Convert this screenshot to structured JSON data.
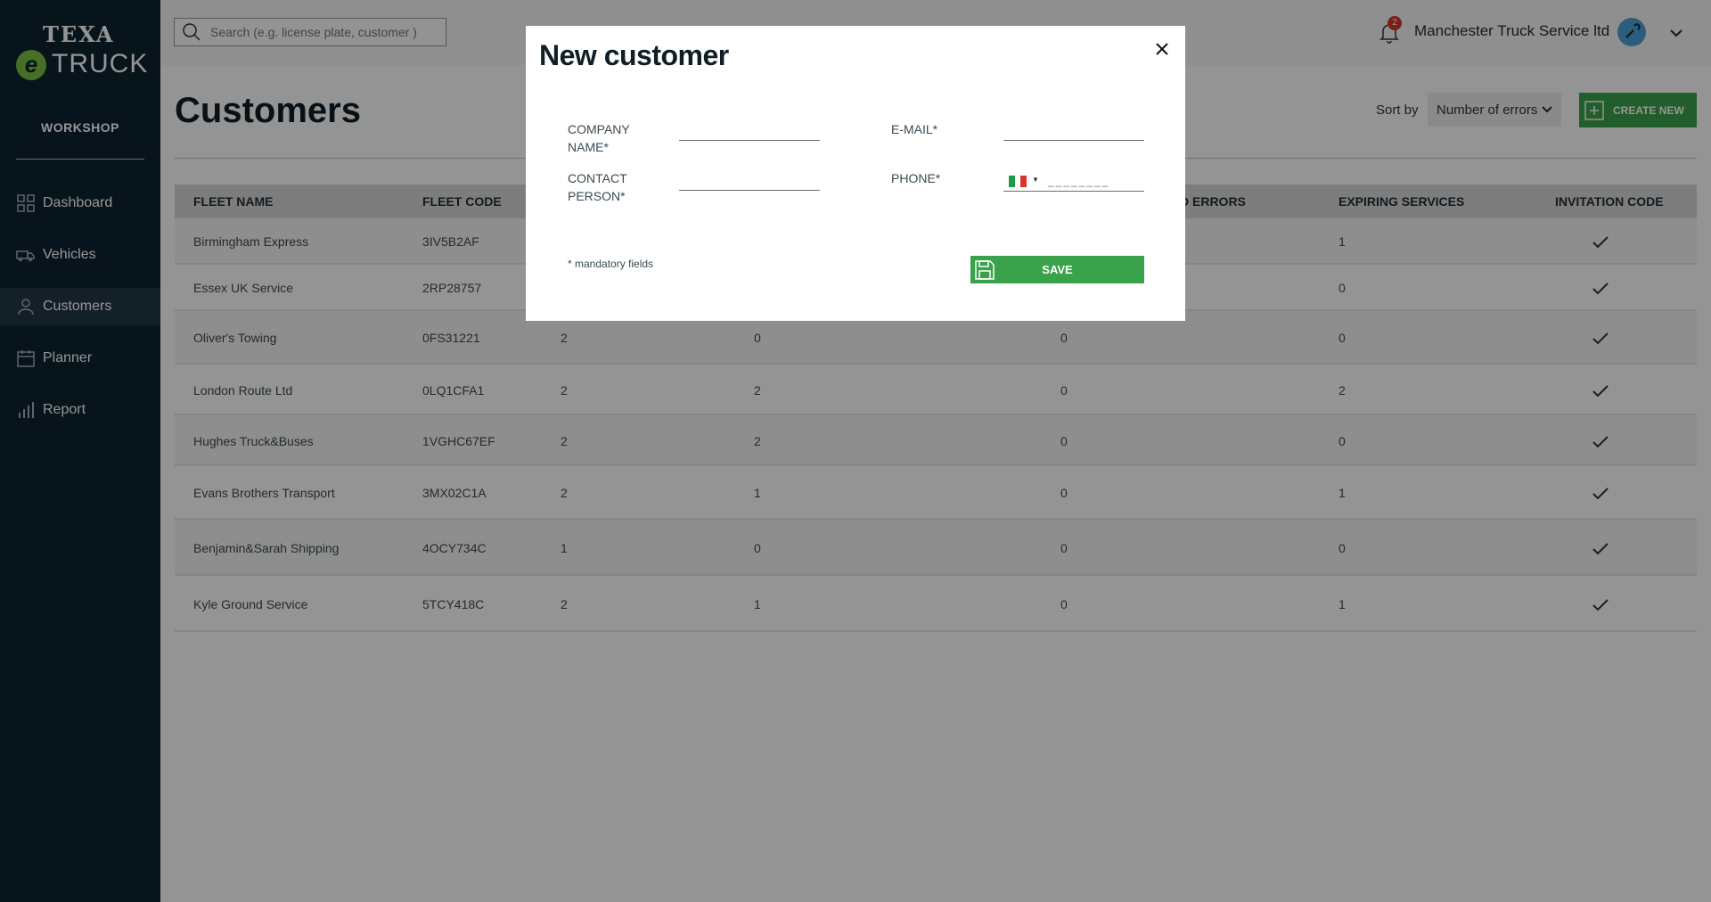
{
  "app": {
    "logo_top": "TEXA",
    "logo_letter": "e",
    "logo_bottom": "TRUCK",
    "section": "WORKSHOP"
  },
  "nav": [
    {
      "label": "Dashboard",
      "icon": "dashboard-icon"
    },
    {
      "label": "Vehicles",
      "icon": "truck-icon"
    },
    {
      "label": "Customers",
      "icon": "person-icon",
      "active": true
    },
    {
      "label": "Planner",
      "icon": "calendar-icon"
    },
    {
      "label": "Report",
      "icon": "bar-chart-icon"
    }
  ],
  "header": {
    "search_placeholder": "Search (e.g. license plate, customer )",
    "notification_count": "2",
    "company": "Manchester Truck Service ltd"
  },
  "page": {
    "title": "Customers",
    "sort_label": "Sort by",
    "sort_value": "Number of errors",
    "create_label": "CREATE NEW"
  },
  "table": {
    "columns": [
      "FLEET NAME",
      "FLEET CODE",
      "",
      "",
      "D ERRORS",
      "EXPIRING SERVICES",
      "INVITATION CODE"
    ],
    "rows": [
      {
        "name": "Birmingham Express",
        "code": "3IV5B2AF",
        "c3": "",
        "c4": "",
        "c5": "",
        "expiring": "1"
      },
      {
        "name": "Essex UK Service",
        "code": "2RP28757",
        "c3": "",
        "c4": "",
        "c5": "",
        "expiring": "0"
      },
      {
        "name": "Oliver's Towing",
        "code": "0FS31221",
        "c3": "2",
        "c4": "0",
        "c5": "0",
        "expiring": "0"
      },
      {
        "name": "London Route Ltd",
        "code": "0LQ1CFA1",
        "c3": "2",
        "c4": "2",
        "c5": "0",
        "expiring": "2"
      },
      {
        "name": "Hughes Truck&Buses",
        "code": "1VGHC67EF",
        "c3": "2",
        "c4": "2",
        "c5": "0",
        "expiring": "0"
      },
      {
        "name": "Evans Brothers Transport",
        "code": "3MX02C1A",
        "c3": "2",
        "c4": "1",
        "c5": "0",
        "expiring": "1"
      },
      {
        "name": "Benjamin&Sarah Shipping",
        "code": "4OCY734C",
        "c3": "1",
        "c4": "0",
        "c5": "0",
        "expiring": "0"
      },
      {
        "name": "Kyle Ground Service",
        "code": "5TCY418C",
        "c3": "2",
        "c4": "1",
        "c5": "0",
        "expiring": "1"
      }
    ]
  },
  "modal": {
    "title": "New customer",
    "company_label": "COMPANY NAME*",
    "company_value": "",
    "email_label": "E-MAIL*",
    "email_value": "",
    "contact_label": "CONTACT PERSON*",
    "contact_value": "",
    "phone_label": "PHONE*",
    "phone_placeholder": "________",
    "phone_country": "Italy",
    "mandatory_note": "* mandatory fields",
    "save_label": "SAVE"
  },
  "colors": {
    "sidebar": "#0e2330",
    "accent_green": "#3aa24a",
    "badge_red": "#d9342b"
  }
}
